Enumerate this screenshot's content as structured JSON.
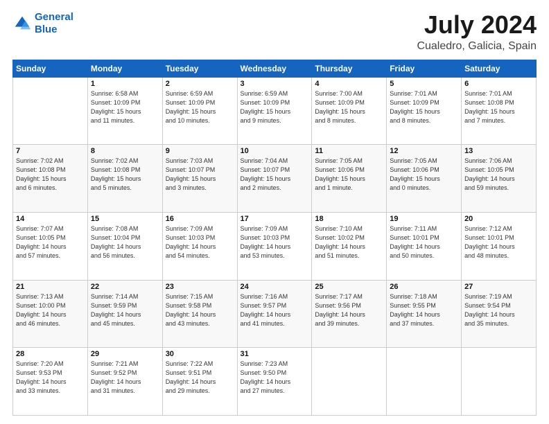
{
  "header": {
    "logo_line1": "General",
    "logo_line2": "Blue",
    "title": "July 2024",
    "subtitle": "Cualedro, Galicia, Spain"
  },
  "days_of_week": [
    "Sunday",
    "Monday",
    "Tuesday",
    "Wednesday",
    "Thursday",
    "Friday",
    "Saturday"
  ],
  "weeks": [
    [
      {
        "day": "",
        "info": ""
      },
      {
        "day": "1",
        "info": "Sunrise: 6:58 AM\nSunset: 10:09 PM\nDaylight: 15 hours\nand 11 minutes."
      },
      {
        "day": "2",
        "info": "Sunrise: 6:59 AM\nSunset: 10:09 PM\nDaylight: 15 hours\nand 10 minutes."
      },
      {
        "day": "3",
        "info": "Sunrise: 6:59 AM\nSunset: 10:09 PM\nDaylight: 15 hours\nand 9 minutes."
      },
      {
        "day": "4",
        "info": "Sunrise: 7:00 AM\nSunset: 10:09 PM\nDaylight: 15 hours\nand 8 minutes."
      },
      {
        "day": "5",
        "info": "Sunrise: 7:01 AM\nSunset: 10:09 PM\nDaylight: 15 hours\nand 8 minutes."
      },
      {
        "day": "6",
        "info": "Sunrise: 7:01 AM\nSunset: 10:08 PM\nDaylight: 15 hours\nand 7 minutes."
      }
    ],
    [
      {
        "day": "7",
        "info": "Sunrise: 7:02 AM\nSunset: 10:08 PM\nDaylight: 15 hours\nand 6 minutes."
      },
      {
        "day": "8",
        "info": "Sunrise: 7:02 AM\nSunset: 10:08 PM\nDaylight: 15 hours\nand 5 minutes."
      },
      {
        "day": "9",
        "info": "Sunrise: 7:03 AM\nSunset: 10:07 PM\nDaylight: 15 hours\nand 3 minutes."
      },
      {
        "day": "10",
        "info": "Sunrise: 7:04 AM\nSunset: 10:07 PM\nDaylight: 15 hours\nand 2 minutes."
      },
      {
        "day": "11",
        "info": "Sunrise: 7:05 AM\nSunset: 10:06 PM\nDaylight: 15 hours\nand 1 minute."
      },
      {
        "day": "12",
        "info": "Sunrise: 7:05 AM\nSunset: 10:06 PM\nDaylight: 15 hours\nand 0 minutes."
      },
      {
        "day": "13",
        "info": "Sunrise: 7:06 AM\nSunset: 10:05 PM\nDaylight: 14 hours\nand 59 minutes."
      }
    ],
    [
      {
        "day": "14",
        "info": "Sunrise: 7:07 AM\nSunset: 10:05 PM\nDaylight: 14 hours\nand 57 minutes."
      },
      {
        "day": "15",
        "info": "Sunrise: 7:08 AM\nSunset: 10:04 PM\nDaylight: 14 hours\nand 56 minutes."
      },
      {
        "day": "16",
        "info": "Sunrise: 7:09 AM\nSunset: 10:03 PM\nDaylight: 14 hours\nand 54 minutes."
      },
      {
        "day": "17",
        "info": "Sunrise: 7:09 AM\nSunset: 10:03 PM\nDaylight: 14 hours\nand 53 minutes."
      },
      {
        "day": "18",
        "info": "Sunrise: 7:10 AM\nSunset: 10:02 PM\nDaylight: 14 hours\nand 51 minutes."
      },
      {
        "day": "19",
        "info": "Sunrise: 7:11 AM\nSunset: 10:01 PM\nDaylight: 14 hours\nand 50 minutes."
      },
      {
        "day": "20",
        "info": "Sunrise: 7:12 AM\nSunset: 10:01 PM\nDaylight: 14 hours\nand 48 minutes."
      }
    ],
    [
      {
        "day": "21",
        "info": "Sunrise: 7:13 AM\nSunset: 10:00 PM\nDaylight: 14 hours\nand 46 minutes."
      },
      {
        "day": "22",
        "info": "Sunrise: 7:14 AM\nSunset: 9:59 PM\nDaylight: 14 hours\nand 45 minutes."
      },
      {
        "day": "23",
        "info": "Sunrise: 7:15 AM\nSunset: 9:58 PM\nDaylight: 14 hours\nand 43 minutes."
      },
      {
        "day": "24",
        "info": "Sunrise: 7:16 AM\nSunset: 9:57 PM\nDaylight: 14 hours\nand 41 minutes."
      },
      {
        "day": "25",
        "info": "Sunrise: 7:17 AM\nSunset: 9:56 PM\nDaylight: 14 hours\nand 39 minutes."
      },
      {
        "day": "26",
        "info": "Sunrise: 7:18 AM\nSunset: 9:55 PM\nDaylight: 14 hours\nand 37 minutes."
      },
      {
        "day": "27",
        "info": "Sunrise: 7:19 AM\nSunset: 9:54 PM\nDaylight: 14 hours\nand 35 minutes."
      }
    ],
    [
      {
        "day": "28",
        "info": "Sunrise: 7:20 AM\nSunset: 9:53 PM\nDaylight: 14 hours\nand 33 minutes."
      },
      {
        "day": "29",
        "info": "Sunrise: 7:21 AM\nSunset: 9:52 PM\nDaylight: 14 hours\nand 31 minutes."
      },
      {
        "day": "30",
        "info": "Sunrise: 7:22 AM\nSunset: 9:51 PM\nDaylight: 14 hours\nand 29 minutes."
      },
      {
        "day": "31",
        "info": "Sunrise: 7:23 AM\nSunset: 9:50 PM\nDaylight: 14 hours\nand 27 minutes."
      },
      {
        "day": "",
        "info": ""
      },
      {
        "day": "",
        "info": ""
      },
      {
        "day": "",
        "info": ""
      }
    ]
  ]
}
